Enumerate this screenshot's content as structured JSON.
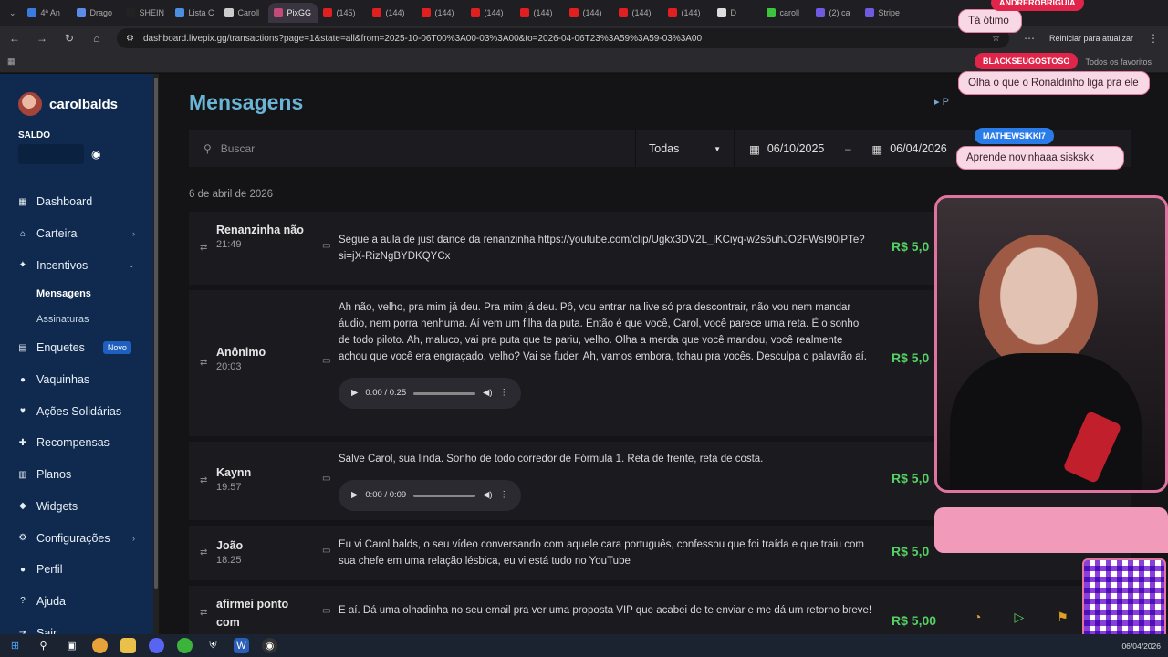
{
  "browser": {
    "tabs": [
      {
        "label": "4ª An",
        "color": "#3a7be0"
      },
      {
        "label": "Drago",
        "color": "#5a8ce8"
      },
      {
        "label": "SHEIN",
        "color": "#222222"
      },
      {
        "label": "Lista C",
        "color": "#4a8fe0"
      },
      {
        "label": "Caroll",
        "color": "#cccccc"
      },
      {
        "label": "PixGG",
        "color": "#c44a7a"
      },
      {
        "label": "(145)",
        "color": "#e02020"
      },
      {
        "label": "(144)",
        "color": "#e02020"
      },
      {
        "label": "(144)",
        "color": "#e02020"
      },
      {
        "label": "(144)",
        "color": "#e02020"
      },
      {
        "label": "(144)",
        "color": "#e02020"
      },
      {
        "label": "(144)",
        "color": "#e02020"
      },
      {
        "label": "(144)",
        "color": "#e02020"
      },
      {
        "label": "(144)",
        "color": "#e02020"
      },
      {
        "label": "D",
        "color": "#dddddd"
      },
      {
        "label": "caroll",
        "color": "#3cc43c"
      },
      {
        "label": "(2) ca",
        "color": "#6f5ae0"
      },
      {
        "label": "Stripe",
        "color": "#6f5ae0"
      }
    ],
    "url": "dashboard.livepix.gg/transactions?page=1&state=all&from=2025-10-06T00%3A00-03%3A00&to=2026-04-06T23%3A59%3A59-03%3A00",
    "restart_label": "Reiniciar para atualizar",
    "bookmarks_right": "Todos os favoritos"
  },
  "sidebar": {
    "username": "carolbalds",
    "saldo_label": "SALDO",
    "items": [
      {
        "label": "Dashboard",
        "icon": "dashboard-icon"
      },
      {
        "label": "Carteira",
        "icon": "bank-icon",
        "chevron": "›"
      },
      {
        "label": "Incentivos",
        "icon": "star-icon",
        "chevron": "⌄"
      },
      {
        "label": "Enquetes",
        "icon": "poll-icon",
        "badge": "Novo"
      },
      {
        "label": "Vaquinhas",
        "icon": "piggy-icon"
      },
      {
        "label": "Ações Solidárias",
        "icon": "heart-icon"
      },
      {
        "label": "Recompensas",
        "icon": "gift-icon"
      },
      {
        "label": "Planos",
        "icon": "layers-icon"
      },
      {
        "label": "Widgets",
        "icon": "widget-icon"
      },
      {
        "label": "Configurações",
        "icon": "gear-icon",
        "chevron": "›"
      },
      {
        "label": "Perfil",
        "icon": "user-icon"
      },
      {
        "label": "Ajuda",
        "icon": "help-icon"
      },
      {
        "label": "Sair",
        "icon": "logout-icon"
      }
    ],
    "subitems": [
      {
        "label": "Mensagens",
        "active": true
      },
      {
        "label": "Assinaturas",
        "active": false
      }
    ]
  },
  "main": {
    "title": "Mensagens",
    "pdf_label": "P",
    "search_placeholder": "Buscar",
    "state_value": "Todas",
    "date_from": "06/10/2025",
    "date_sep": "–",
    "date_to": "06/04/2026",
    "day_label": "6 de abril de 2026",
    "rows": [
      {
        "name": "Renanzinha não",
        "time": "21:49",
        "message": "Segue a aula de just dance da renanzinha https://youtube.com/clip/Ugkx3DV2L_lKCiyq-w2s6uhJO2FWsI90iPTe?si=jX-RizNgBYDKQYCx",
        "amount": "R$ 5,0",
        "audio": null
      },
      {
        "name": "Anônimo",
        "time": "20:03",
        "message": "Ah não, velho, pra mim já deu. Pra mim já deu. Pô, vou entrar na live só pra descontrair, não vou nem mandar áudio, nem porra nenhuma. Aí vem um filha da puta. Então é que você, Carol, você parece uma reta. É o sonho de todo piloto. Ah, maluco, vai pra puta que te pariu, velho. Olha a merda que você mandou, você realmente achou que você era engraçado, velho? Vai se fuder. Ah, vamos embora, tchau pra vocês. Desculpa o palavrão aí.",
        "amount": "R$ 5,0",
        "audio": "0:00 / 0:25"
      },
      {
        "name": "Kaynn",
        "time": "19:57",
        "message": "Salve Carol, sua linda. Sonho de todo corredor de Fórmula 1. Reta de frente, reta de costa.",
        "amount": "R$ 5,0",
        "audio": "0:00 / 0:09"
      },
      {
        "name": "João",
        "time": "18:25",
        "message": "Eu vi Carol balds, o seu vídeo conversando com aquele cara português, confessou que foi traída e que traiu com sua chefe em uma relação lésbica, eu vi está tudo no YouTube",
        "amount": "R$ 5,0",
        "audio": null
      },
      {
        "name": "afirmei ponto com",
        "time": "",
        "message": "E aí. Dá uma olhadinha no seu email pra ver uma proposta VIP que acabei de te enviar e me dá um retorno breve!",
        "amount": "R$ 5,00",
        "audio": null
      }
    ]
  },
  "overlay": {
    "chats": [
      {
        "user": "ANDREROBRIGUIA",
        "text": "Tá ótimo"
      },
      {
        "user": "BLACKSEUGOSTOSO",
        "text": "Olha o que o Ronaldinho liga pra ele"
      },
      {
        "user": "MATHEWSIKKI7",
        "text": "Aprende novinhaaa siskskk"
      }
    ]
  },
  "taskbar": {
    "clock": "06/04/2026"
  }
}
